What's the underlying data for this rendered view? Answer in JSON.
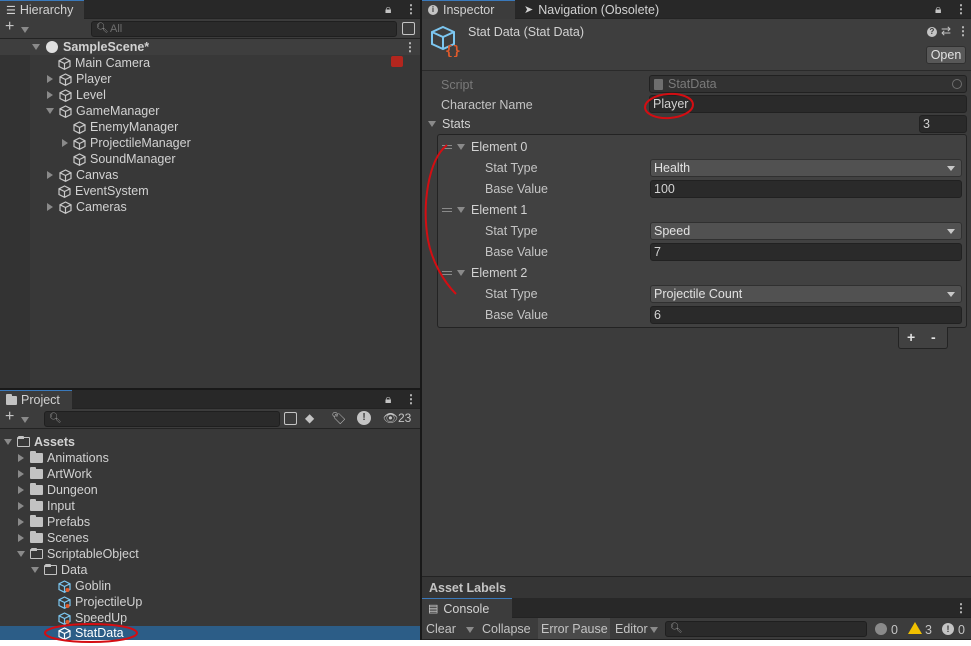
{
  "hierarchy": {
    "tab_label": "Hierarchy",
    "search_placeholder": "All",
    "scene_name": "SampleScene*",
    "items": [
      {
        "label": "Main Camera"
      },
      {
        "label": "Player"
      },
      {
        "label": "Level"
      },
      {
        "label": "GameManager"
      },
      {
        "label": "EnemyManager"
      },
      {
        "label": "ProjectileManager"
      },
      {
        "label": "SoundManager"
      },
      {
        "label": "Canvas"
      },
      {
        "label": "EventSystem"
      },
      {
        "label": "Cameras"
      }
    ]
  },
  "project": {
    "tab_label": "Project",
    "hidden_count": "23",
    "root": "Assets",
    "folders": [
      {
        "label": "Animations"
      },
      {
        "label": "ArtWork"
      },
      {
        "label": "Dungeon"
      },
      {
        "label": "Input"
      },
      {
        "label": "Prefabs"
      },
      {
        "label": "Scenes"
      },
      {
        "label": "ScriptableObject"
      },
      {
        "label": "Data"
      }
    ],
    "assets": [
      {
        "label": "Goblin"
      },
      {
        "label": "ProjectileUp"
      },
      {
        "label": "SpeedUp"
      },
      {
        "label": "StatData"
      }
    ]
  },
  "inspector": {
    "tab_label": "Inspector",
    "tab2_label": "Navigation (Obsolete)",
    "title": "Stat Data (Stat Data)",
    "open_label": "Open",
    "script_label": "Script",
    "script_value": "StatData",
    "char_name_label": "Character Name",
    "char_name_value": "Player",
    "stats_label": "Stats",
    "stats_count": "3",
    "stat_type_label": "Stat Type",
    "base_value_label": "Base Value",
    "elements": [
      {
        "name": "Element 0",
        "stat_type": "Health",
        "base_value": "100"
      },
      {
        "name": "Element 1",
        "stat_type": "Speed",
        "base_value": "7"
      },
      {
        "name": "Element 2",
        "stat_type": "Projectile Count",
        "base_value": "6"
      }
    ],
    "add_label": "+",
    "remove_label": "-",
    "asset_labels": "Asset Labels"
  },
  "console": {
    "tab_label": "Console",
    "clear_label": "Clear",
    "collapse_label": "Collapse",
    "error_pause_label": "Error Pause",
    "editor_label": "Editor",
    "info_count": "0",
    "warn_count": "3",
    "error_count": "0"
  },
  "colors": {
    "panel_bg": "#383838",
    "selection": "#2c5d87",
    "annotation_red": "#d40d12"
  }
}
